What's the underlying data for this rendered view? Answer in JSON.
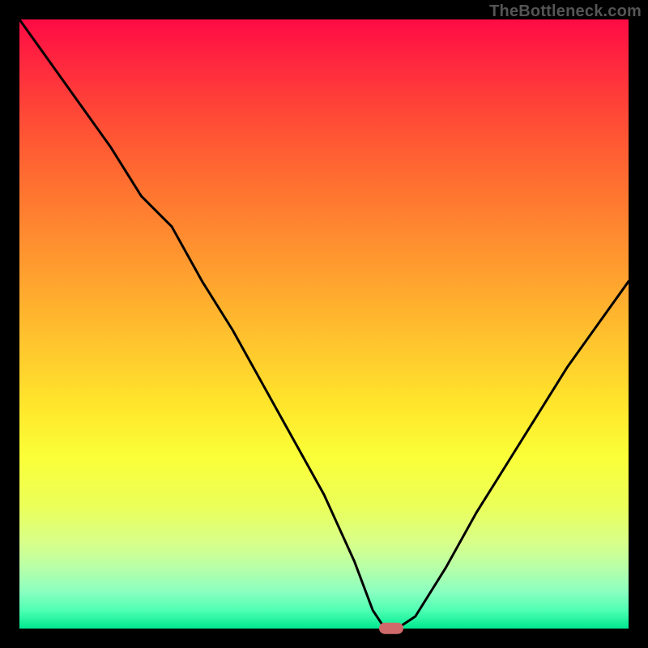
{
  "caption": "TheBottleneck.com",
  "colors": {
    "frame": "#000000",
    "marker": "#d06a6a",
    "curve": "#000000",
    "caption": "#555555"
  },
  "chart_data": {
    "type": "line",
    "title": "",
    "xlabel": "",
    "ylabel": "",
    "xlim": [
      0,
      100
    ],
    "ylim": [
      0,
      100
    ],
    "grid": false,
    "legend": false,
    "annotations": [],
    "series": [
      {
        "name": "bottleneck-curve",
        "x": [
          0,
          5,
          10,
          15,
          20,
          25,
          30,
          35,
          40,
          45,
          50,
          55,
          58,
          60,
          62,
          65,
          70,
          75,
          80,
          85,
          90,
          95,
          100
        ],
        "values": [
          100,
          93,
          86,
          79,
          71,
          66,
          57,
          49,
          40,
          31,
          22,
          11,
          3,
          0,
          0,
          2,
          10,
          19,
          27,
          35,
          43,
          50,
          57
        ]
      }
    ],
    "marker": {
      "x": 61,
      "y": 0
    },
    "background_gradient": {
      "direction": "vertical",
      "stops": [
        {
          "pos": 0,
          "color": "#ff0b45"
        },
        {
          "pos": 50,
          "color": "#ffc62d"
        },
        {
          "pos": 75,
          "color": "#f6ff3a"
        },
        {
          "pos": 100,
          "color": "#00e890"
        }
      ]
    }
  }
}
